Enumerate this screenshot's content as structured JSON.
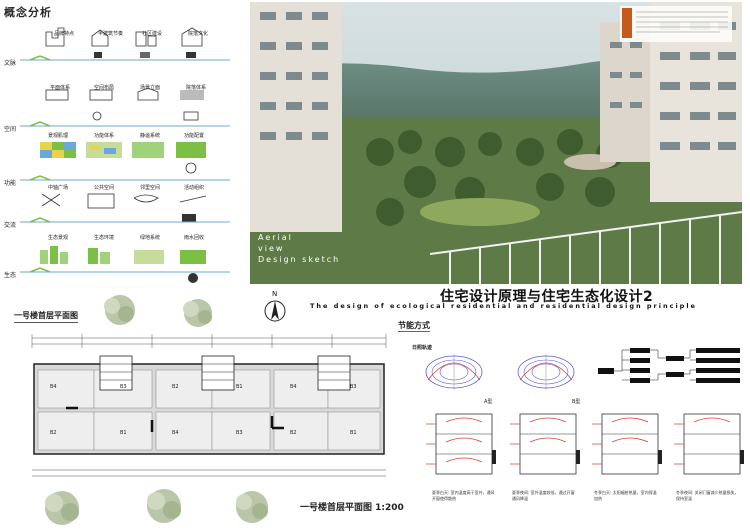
{
  "concept": {
    "title": "概念分析",
    "rows": [
      {
        "label": "文脉",
        "tags": [
          "品牌特点",
          "半建筑节奏",
          "社区建设",
          "院落文化"
        ]
      },
      {
        "label": "空间",
        "tags": [
          "平面体系",
          "空间布局",
          "场景立面",
          "院落体系"
        ]
      },
      {
        "label": "功能",
        "tags": [
          "景观肌理",
          "功能体系",
          "静谧系统",
          "功能配置"
        ]
      },
      {
        "label": "交流",
        "tags": [
          "中轴广场",
          "公共空间",
          "邻里空间",
          "活动组织"
        ]
      },
      {
        "label": "生态",
        "tags": [
          "生态景观",
          "生态环境",
          "绿地系统",
          "雨水回收"
        ]
      }
    ]
  },
  "hero": {
    "caption_line1": "Aerial",
    "caption_line2": "view",
    "caption_line3": "Design sketch"
  },
  "header": {
    "title": "住宅设计原理与住宅生态化设计2",
    "subtitle": "The design of ecological residential and residential design principle"
  },
  "north": "N",
  "plan": {
    "title_top": "一号楼首层平面图",
    "title_bottom": "一号楼首层平面图 1:200",
    "room_labels": [
      "B4",
      "B3",
      "B2",
      "B1",
      "B4",
      "B3",
      "B2",
      "B1",
      "B4",
      "B3",
      "B2",
      "B1"
    ]
  },
  "energy": {
    "title": "节能方式",
    "sun_label": "日照轨迹",
    "type_a": "A型",
    "type_b": "B型",
    "notes": [
      "夏季白天: 室内温度高于室外，通风开窗使得散热",
      "夏季夜间: 室外温度较低，通过开窗通风降温",
      "冬季白天: 太阳辐射热量，室内保温加热",
      "冬季夜间: 关闭门窗减少热量损失，保持室温"
    ]
  },
  "colors": {
    "sky": "#cfdbe0",
    "tree_dark": "#3f5c2e",
    "tree_light": "#8ea95d",
    "concept_green": "#7bbf45",
    "concept_blue": "#6aa8d9",
    "concept_yellow": "#e8d44c",
    "wind_red": "#d6453a"
  }
}
